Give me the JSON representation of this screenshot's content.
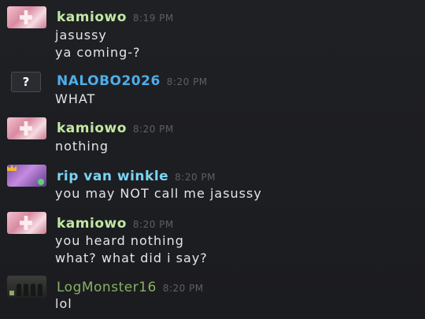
{
  "colors": {
    "background": "#1d1e22",
    "kamiowo": "#c2e8a3",
    "nalobo": "#4faee8",
    "ripvanwinkle": "#7ad4f2",
    "logmonster": "#88b064",
    "timestamp": "#5d5f66",
    "message_text": "#e4e5e8"
  },
  "messages": [
    {
      "avatar_icon": "pink-anime-avatar-icon",
      "username": "kamiowo",
      "time": "8:19 PM",
      "lines": [
        "jasussy",
        "ya coming-?"
      ]
    },
    {
      "avatar_icon": "question-mark-avatar-icon",
      "avatar_text": "?",
      "username": "NALOBO2026",
      "time": "8:20 PM",
      "lines": [
        "WHAT"
      ]
    },
    {
      "avatar_icon": "pink-anime-avatar-icon",
      "username": "kamiowo",
      "time": "8:20 PM",
      "lines": [
        "nothing"
      ]
    },
    {
      "avatar_icon": "purple-avatar-with-crown-icon",
      "username": "rip van winkle",
      "time": "8:20 PM",
      "lines": [
        "you may NOT call me jasussy"
      ]
    },
    {
      "avatar_icon": "pink-anime-avatar-icon",
      "username": "kamiowo",
      "time": "8:20 PM",
      "lines": [
        "you heard nothing",
        "what? what did i say?"
      ]
    },
    {
      "avatar_icon": "band-photo-avatar-icon",
      "username": "LogMonster16",
      "time": "8:20 PM",
      "lines": [
        "lol"
      ]
    }
  ]
}
